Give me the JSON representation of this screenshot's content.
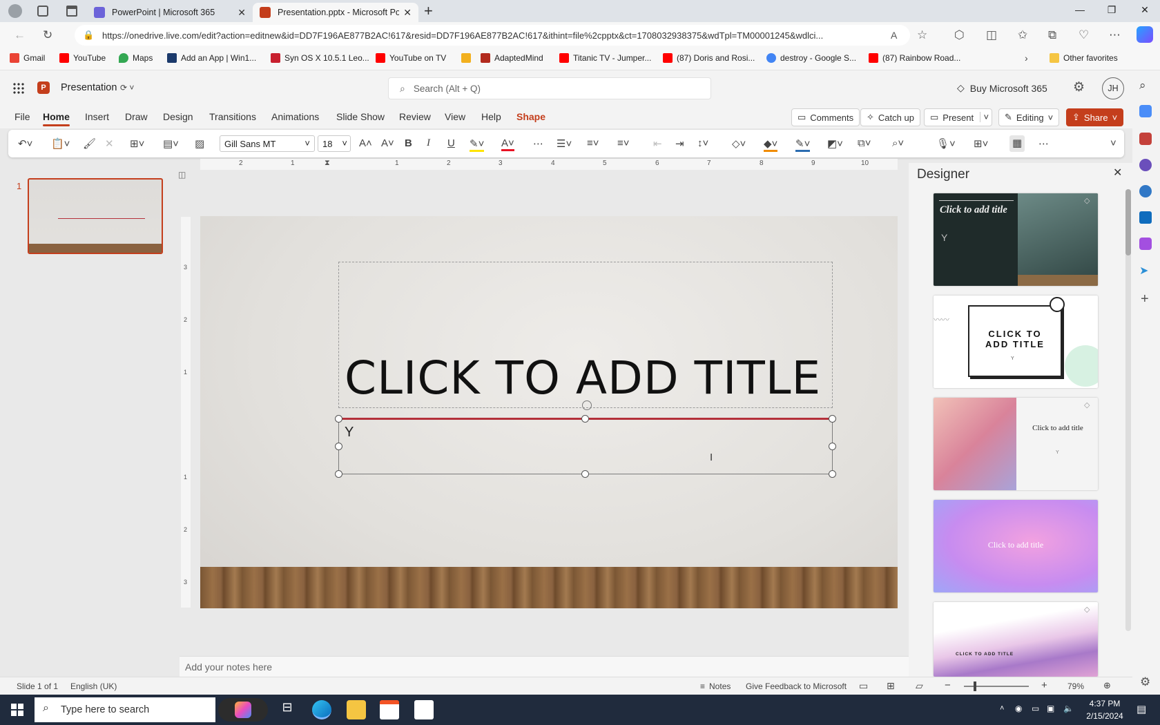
{
  "browser": {
    "tabs": [
      {
        "label": "PowerPoint | Microsoft 365",
        "active": false
      },
      {
        "label": "Presentation.pptx - Microsoft Po",
        "active": true
      }
    ],
    "url": "https://onedrive.live.com/edit?action=editnew&id=DD7F196AE877B2AC!617&resid=DD7F196AE877B2AC!617&ithint=file%2cpptx&ct=1708032938375&wdTpl=TM00001245&wdlci...",
    "favorites": [
      {
        "label": "Gmail",
        "color": "#ea4335"
      },
      {
        "label": "YouTube",
        "color": "#ff0000"
      },
      {
        "label": "Maps",
        "color": "#34a853"
      },
      {
        "label": "Add an App | Win1...",
        "color": "#1b3a6b"
      },
      {
        "label": "Syn OS X 10.5.1 Leo...",
        "color": "#c8202f"
      },
      {
        "label": "YouTube on TV",
        "color": "#ff0000"
      },
      {
        "label": "",
        "color": "#f2b01e"
      },
      {
        "label": "AdaptedMind",
        "color": "#b22a1d"
      },
      {
        "label": "Titanic TV - Jumper...",
        "color": "#ff0000"
      },
      {
        "label": "(87) Doris and Rosi...",
        "color": "#ff0000"
      },
      {
        "label": "destroy - Google S...",
        "color": "#4285f4"
      },
      {
        "label": "(87) Rainbow Road...",
        "color": "#ff0000"
      }
    ],
    "other_favorites": "Other favorites"
  },
  "app": {
    "doc_title": "Presentation",
    "search_placeholder": "Search (Alt + Q)",
    "buy": "Buy Microsoft 365",
    "avatar": "JH",
    "menu": [
      "File",
      "Home",
      "Insert",
      "Draw",
      "Design",
      "Transitions",
      "Animations",
      "Slide Show",
      "Review",
      "View",
      "Help",
      "Shape"
    ],
    "active_menu": "Home",
    "comments": "Comments",
    "catch_up": "Catch up",
    "present": "Present",
    "editing": "Editing",
    "share": "Share",
    "accent": "#c43e1c"
  },
  "ribbon": {
    "font_name": "Gill Sans MT",
    "font_size": "18"
  },
  "thumbnails": [
    {
      "number": "1"
    }
  ],
  "ruler": {
    "h_ticks": [
      "2",
      "1",
      "1",
      "2",
      "3",
      "4",
      "5",
      "6",
      "7",
      "8",
      "9",
      "10"
    ],
    "v_ticks": [
      "3",
      "2",
      "1",
      "1",
      "2",
      "3"
    ]
  },
  "slide": {
    "title": "CLICK TO ADD TITLE",
    "subtitle": "Y"
  },
  "designer": {
    "heading": "Designer",
    "cards": [
      {
        "title": "Click to add title",
        "subtitle": "Y"
      },
      {
        "title": "CLICK TO ADD TITLE",
        "subtitle": "Y"
      },
      {
        "title": "Click to add title",
        "subtitle": "Y"
      },
      {
        "title": "Click to add title",
        "subtitle": ""
      },
      {
        "title": "CLICK TO ADD TITLE",
        "subtitle": ""
      }
    ]
  },
  "notes_placeholder": "Add your notes here",
  "status": {
    "slide_info": "Slide 1 of 1",
    "language": "English (UK)",
    "notes": "Notes",
    "feedback": "Give Feedback to Microsoft",
    "zoom": "79%"
  },
  "taskbar": {
    "search_placeholder": "Type here to search",
    "time": "4:37 PM",
    "date": "2/15/2024"
  }
}
